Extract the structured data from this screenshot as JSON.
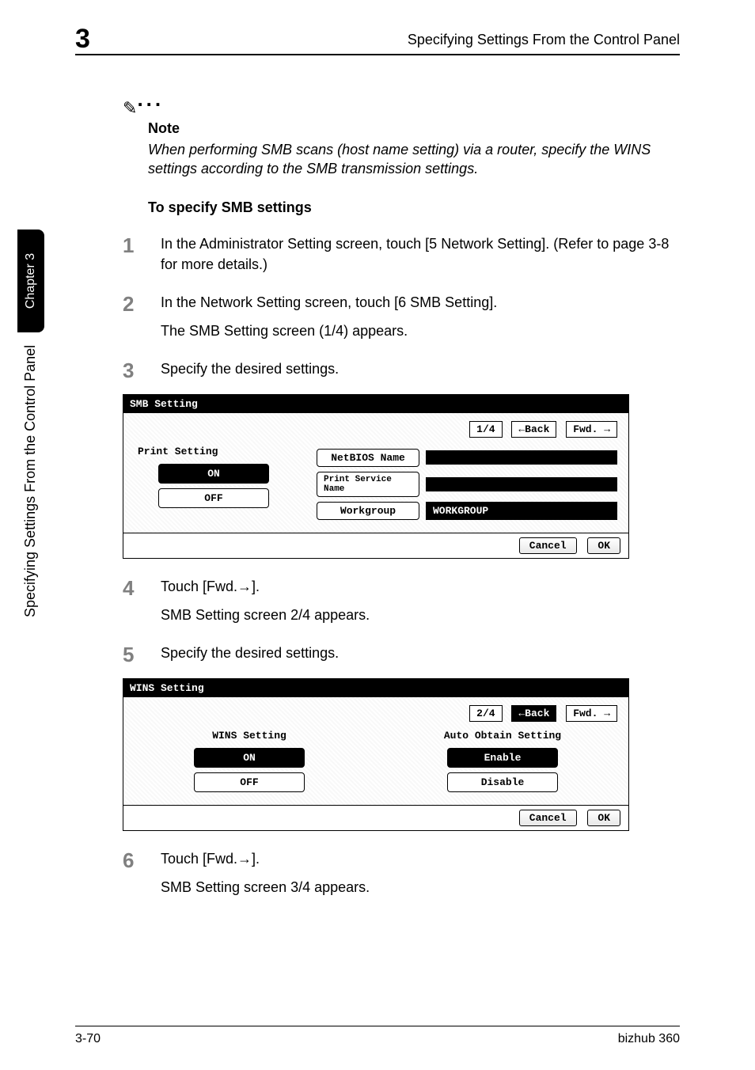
{
  "header": {
    "chapter_number": "3",
    "title_right": "Specifying Settings From the Control Panel"
  },
  "side": {
    "tab_label": "Chapter 3",
    "vertical_text": "Specifying Settings From the Control Panel"
  },
  "note": {
    "label": "Note",
    "body": "When performing SMB scans (host name setting) via a router, specify the WINS settings according to the SMB transmission settings."
  },
  "subheading": "To specify SMB settings",
  "steps": {
    "s1": {
      "num": "1",
      "text": "In the Administrator Setting screen, touch [5 Network Setting]. (Refer to page 3-8 for more details.)"
    },
    "s2": {
      "num": "2",
      "text": "In the Network Setting screen, touch [6 SMB Setting].",
      "sub": "The SMB Setting screen (1/4) appears."
    },
    "s3": {
      "num": "3",
      "text": "Specify the desired settings."
    },
    "s4": {
      "num": "4",
      "text": "Touch [Fwd.→].",
      "sub": "SMB Setting screen 2/4 appears."
    },
    "s5": {
      "num": "5",
      "text": "Specify the desired settings."
    },
    "s6": {
      "num": "6",
      "text": "Touch [Fwd.→].",
      "sub": "SMB Setting screen 3/4 appears."
    }
  },
  "panel1": {
    "title": "SMB Setting",
    "page": "1/4",
    "back": "←Back",
    "fwd": "Fwd. →",
    "left_label": "Print Setting",
    "on": "ON",
    "off": "OFF",
    "netbios": "NetBIOS Name",
    "print_service": "Print Service Name",
    "workgroup_btn": "Workgroup",
    "workgroup_val": "WORKGROUP",
    "cancel": "Cancel",
    "ok": "OK"
  },
  "panel2": {
    "title": "WINS Setting",
    "page": "2/4",
    "back": "←Back",
    "fwd": "Fwd. →",
    "left_label": "WINS Setting",
    "right_label": "Auto Obtain Setting",
    "on": "ON",
    "off": "OFF",
    "enable": "Enable",
    "disable": "Disable",
    "cancel": "Cancel",
    "ok": "OK"
  },
  "footer": {
    "left": "3-70",
    "right": "bizhub 360"
  }
}
